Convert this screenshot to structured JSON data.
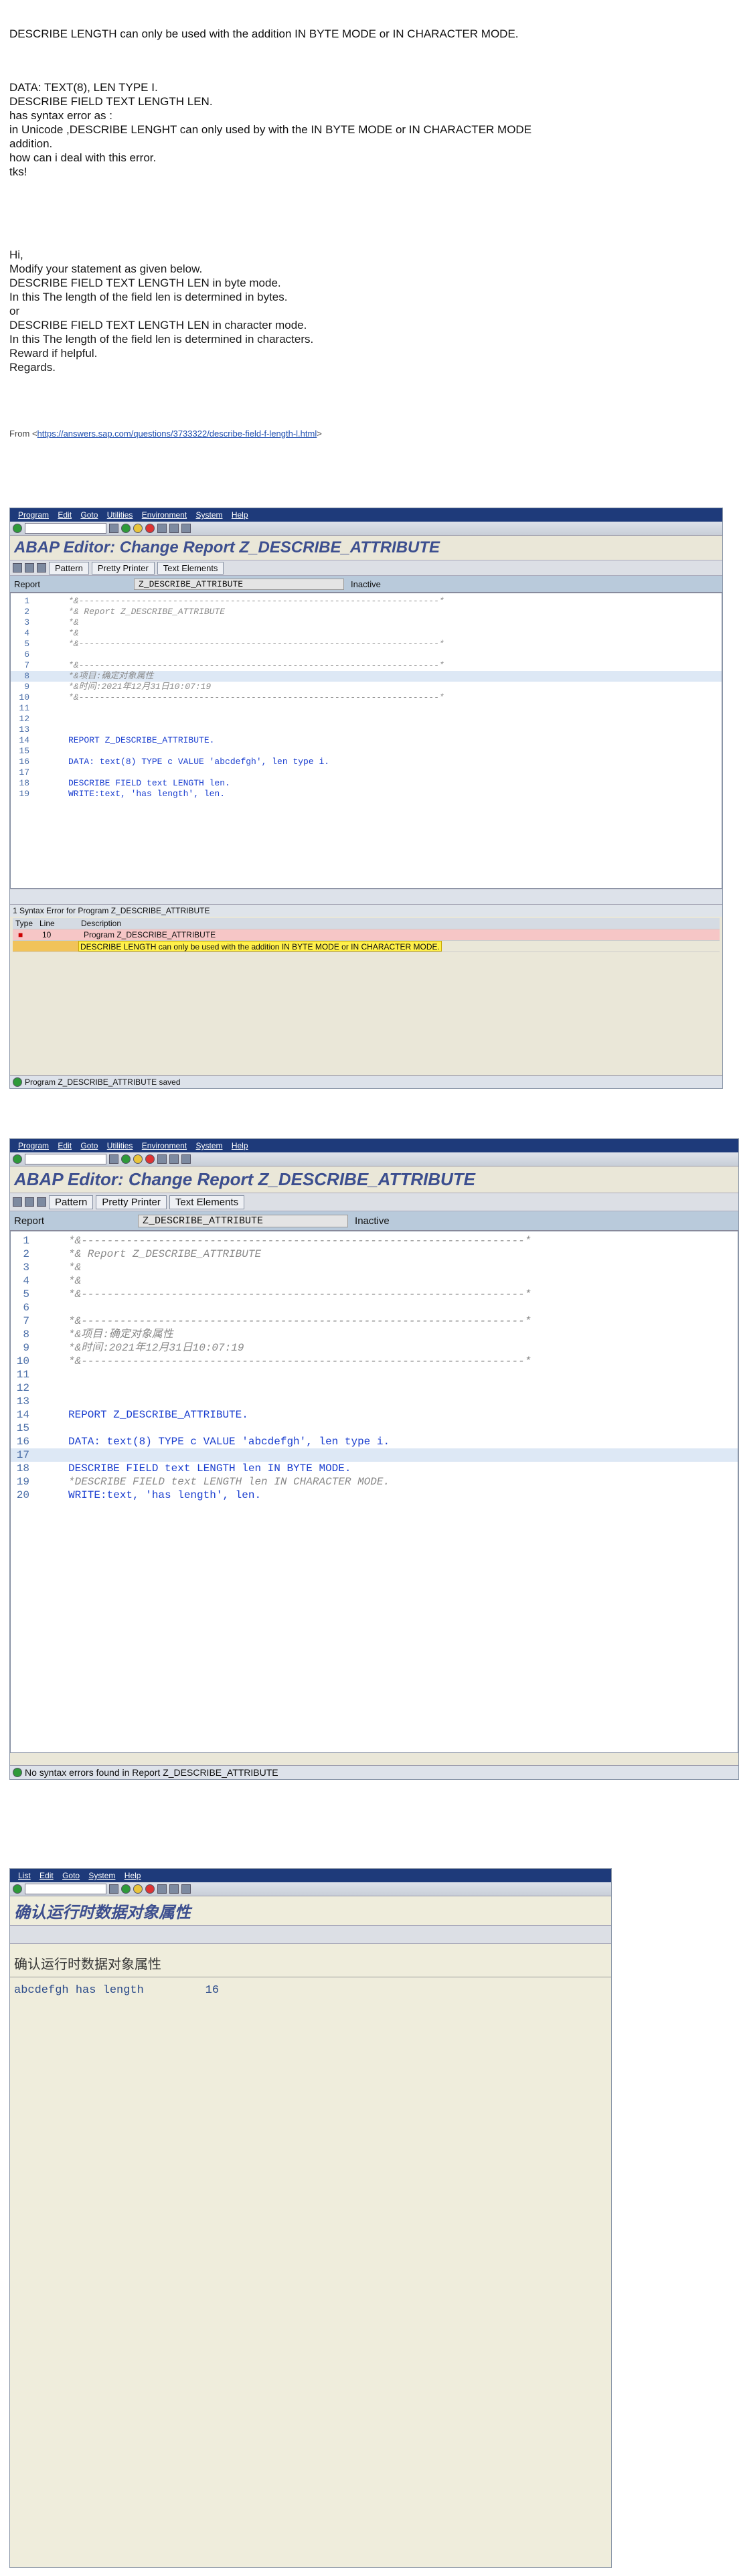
{
  "note": {
    "title": "DESCRIBE LENGTH can only be used with the addition IN BYTE MODE or IN CHARACTER MODE.",
    "question": [
      "DATA: TEXT(8), LEN TYPE I.",
      "DESCRIBE FIELD TEXT LENGTH LEN.",
      "has syntax error as :",
      "in Unicode ,DESCRIBE LENGHT can only used by with the IN BYTE MODE or IN CHARACTER MODE",
      "addition.",
      "how can i deal with this error.",
      "tks!"
    ],
    "answer": [
      "Hi,",
      "Modify your statement as given below.",
      "DESCRIBE FIELD TEXT LENGTH LEN in byte mode.",
      "In this The length of the field len is determined in bytes.",
      "or",
      "DESCRIBE FIELD TEXT LENGTH LEN in character mode.",
      "In this The length of the field len is determined in characters.",
      "Reward if helpful.",
      "Regards."
    ],
    "from_label": "From <",
    "from_link": "https://answers.sap.com/questions/3733322/describe-field-f-length-l.html",
    "from_end": ">"
  },
  "screen1": {
    "menu": [
      "Program",
      "Edit",
      "Goto",
      "Utilities",
      "Environment",
      "System",
      "Help"
    ],
    "title": "ABAP Editor: Change Report Z_DESCRIBE_ATTRIBUTE",
    "buttons": [
      "Pattern",
      "Pretty Printer",
      "Text Elements"
    ],
    "report_label": "Report",
    "report_value": "Z_DESCRIBE_ATTRIBUTE",
    "report_status": "Inactive",
    "lines": [
      {
        "n": "1",
        "t": "*&---------------------------------------------------------------------*",
        "c": "cm"
      },
      {
        "n": "2",
        "t": "*& Report Z_DESCRIBE_ATTRIBUTE",
        "c": "cm"
      },
      {
        "n": "3",
        "t": "*&",
        "c": "cm"
      },
      {
        "n": "4",
        "t": "*&",
        "c": "cm"
      },
      {
        "n": "5",
        "t": "*&---------------------------------------------------------------------*",
        "c": "cm"
      },
      {
        "n": "6",
        "t": "",
        "c": ""
      },
      {
        "n": "7",
        "t": "*&---------------------------------------------------------------------*",
        "c": "cm"
      },
      {
        "n": "8",
        "t": "*&项目:确定对象属性",
        "c": "cm"
      },
      {
        "n": "9",
        "t": "*&时间:2021年12月31日10:07:19",
        "c": "cm"
      },
      {
        "n": "10",
        "t": "*&---------------------------------------------------------------------*",
        "c": "cm"
      },
      {
        "n": "11",
        "t": "",
        "c": ""
      },
      {
        "n": "12",
        "t": "",
        "c": ""
      },
      {
        "n": "13",
        "t": "",
        "c": ""
      },
      {
        "n": "14",
        "t": "REPORT Z_DESCRIBE_ATTRIBUTE.",
        "c": "kw"
      },
      {
        "n": "15",
        "t": "",
        "c": ""
      },
      {
        "n": "16",
        "t": "DATA: text(8) TYPE c VALUE 'abcdefgh', len type i.",
        "c": "kw"
      },
      {
        "n": "17",
        "t": "",
        "c": ""
      },
      {
        "n": "18",
        "t": "DESCRIBE FIELD text LENGTH len.",
        "c": "kw"
      },
      {
        "n": "19",
        "t": "WRITE:text, 'has length', len.",
        "c": "kw"
      }
    ],
    "err_header": "1 Syntax Error for Program Z_DESCRIBE_ATTRIBUTE",
    "err_cols": [
      "Type",
      "Line",
      "Description"
    ],
    "err_line": "10",
    "err_program": "Program Z_DESCRIBE_ATTRIBUTE",
    "err_msg": "DESCRIBE LENGTH can only be used with the addition IN BYTE MODE or IN CHARACTER MODE.",
    "status": "Program Z_DESCRIBE_ATTRIBUTE saved"
  },
  "screen2": {
    "menu": [
      "Program",
      "Edit",
      "Goto",
      "Utilities",
      "Environment",
      "System",
      "Help"
    ],
    "title": "ABAP Editor: Change Report Z_DESCRIBE_ATTRIBUTE",
    "buttons": [
      "Pattern",
      "Pretty Printer",
      "Text Elements"
    ],
    "report_label": "Report",
    "report_value": "Z_DESCRIBE_ATTRIBUTE",
    "report_status": "Inactive",
    "lines": [
      {
        "n": "1",
        "t": "*&---------------------------------------------------------------------*",
        "c": "cm"
      },
      {
        "n": "2",
        "t": "*& Report Z_DESCRIBE_ATTRIBUTE",
        "c": "cm"
      },
      {
        "n": "3",
        "t": "*&",
        "c": "cm"
      },
      {
        "n": "4",
        "t": "*&",
        "c": "cm"
      },
      {
        "n": "5",
        "t": "*&---------------------------------------------------------------------*",
        "c": "cm"
      },
      {
        "n": "6",
        "t": "",
        "c": ""
      },
      {
        "n": "7",
        "t": "*&---------------------------------------------------------------------*",
        "c": "cm"
      },
      {
        "n": "8",
        "t": "*&项目:确定对象属性",
        "c": "cm"
      },
      {
        "n": "9",
        "t": "*&时间:2021年12月31日10:07:19",
        "c": "cm"
      },
      {
        "n": "10",
        "t": "*&---------------------------------------------------------------------*",
        "c": "cm"
      },
      {
        "n": "11",
        "t": "",
        "c": ""
      },
      {
        "n": "12",
        "t": "",
        "c": ""
      },
      {
        "n": "13",
        "t": "",
        "c": ""
      },
      {
        "n": "14",
        "t": "REPORT Z_DESCRIBE_ATTRIBUTE.",
        "c": "kw"
      },
      {
        "n": "15",
        "t": "",
        "c": ""
      },
      {
        "n": "16",
        "t": "DATA: text(8) TYPE c VALUE 'abcdefgh', len type i.",
        "c": "kw"
      },
      {
        "n": "17",
        "t": "",
        "c": ""
      },
      {
        "n": "18",
        "t": "DESCRIBE FIELD text LENGTH len IN BYTE MODE.",
        "c": "kw"
      },
      {
        "n": "19",
        "t": "*DESCRIBE FIELD text LENGTH len IN CHARACTER MODE.",
        "c": "cm"
      },
      {
        "n": "20",
        "t": "WRITE:text, 'has length', len.",
        "c": "kw"
      }
    ],
    "status": "No syntax errors found in Report Z_DESCRIBE_ATTRIBUTE"
  },
  "screen3": {
    "menu": [
      "List",
      "Edit",
      "Goto",
      "System",
      "Help"
    ],
    "title": "确认运行时数据对象属性",
    "subtitle": "确认运行时数据对象属性",
    "output": "abcdefgh has length         16"
  }
}
